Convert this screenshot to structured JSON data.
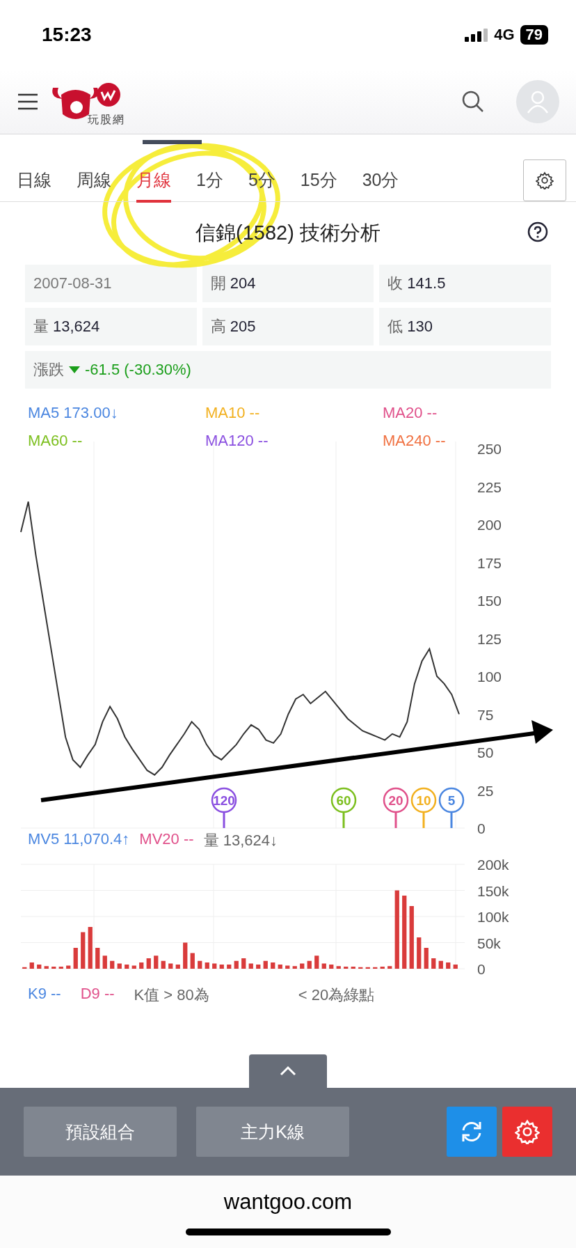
{
  "status_bar": {
    "time": "15:23",
    "network": "4G",
    "battery": "79"
  },
  "header": {
    "logo_text": "玩股網"
  },
  "tabs": [
    {
      "label": "日線",
      "selected": false
    },
    {
      "label": "周線",
      "selected": false
    },
    {
      "label": "月線",
      "selected": true
    },
    {
      "label": "1分",
      "selected": false
    },
    {
      "label": "5分",
      "selected": false
    },
    {
      "label": "15分",
      "selected": false
    },
    {
      "label": "30分",
      "selected": false
    }
  ],
  "title": "信錦(1582) 技術分析",
  "quote": [
    {
      "value": "2007-08-31"
    },
    {
      "label": "開",
      "value": "204"
    },
    {
      "label": "收",
      "value": "141.5"
    },
    {
      "label": "量",
      "value": "13,624"
    },
    {
      "label": "高",
      "value": "205"
    },
    {
      "label": "低",
      "value": "130"
    }
  ],
  "change": {
    "label": "漲跌",
    "value": "-61.5 (-30.30%)",
    "falling": true
  },
  "ma_legend": [
    {
      "name": "MA5",
      "value": "173.00↓",
      "color": "#4a86e0"
    },
    {
      "name": "MA10",
      "value": "--",
      "color": "#f2b01e"
    },
    {
      "name": "MA20",
      "value": "--",
      "color": "#e0508a"
    },
    {
      "name": "MA60",
      "value": "--",
      "color": "#7cbf1e"
    },
    {
      "name": "MA120",
      "value": "--",
      "color": "#8a4fe0"
    },
    {
      "name": "MA240",
      "value": "--",
      "color": "#f07040"
    }
  ],
  "price_chart": {
    "chart_data": {
      "type": "line",
      "grid": true,
      "categories": [
        null,
        null,
        null,
        null,
        null,
        null,
        null,
        null,
        null,
        null,
        null,
        null,
        null,
        null,
        null,
        null,
        null,
        null,
        null,
        null,
        null,
        null,
        null,
        null,
        null,
        null,
        null,
        null,
        null,
        null,
        null,
        null,
        null,
        null,
        null,
        null,
        null,
        null,
        null,
        null,
        null,
        null,
        null,
        null,
        null,
        null,
        null,
        null,
        null,
        null,
        null,
        null,
        null,
        null,
        null,
        null,
        null,
        null,
        null,
        null
      ],
      "ylim": [
        0,
        250
      ],
      "yticks": [
        0,
        25,
        50,
        75,
        100,
        125,
        150,
        175,
        200,
        225,
        250
      ],
      "series": [
        {
          "color": "#333333",
          "values": [
            195,
            215,
            180,
            150,
            120,
            90,
            60,
            45,
            40,
            48,
            55,
            70,
            80,
            72,
            60,
            52,
            45,
            38,
            35,
            40,
            48,
            55,
            62,
            70,
            65,
            55,
            48,
            45,
            50,
            55,
            62,
            68,
            65,
            58,
            56,
            62,
            75,
            85,
            88,
            82,
            86,
            90,
            84,
            78,
            72,
            68,
            64,
            62,
            60,
            58,
            62,
            60,
            70,
            95,
            110,
            118,
            100,
            95,
            88,
            75
          ]
        }
      ]
    },
    "markers": [
      {
        "label": "120",
        "color": "#8a4fe0"
      },
      {
        "label": "60",
        "color": "#7cbf1e"
      },
      {
        "label": "20",
        "color": "#e0508a"
      },
      {
        "label": "10",
        "color": "#f2b01e"
      },
      {
        "label": "5",
        "color": "#4a86e0"
      }
    ]
  },
  "volume_legend": [
    {
      "text": "MV5 11,070.4↑",
      "color": "#4a86e0"
    },
    {
      "text": "MV20 --",
      "color": "#e0508a"
    },
    {
      "text": "量 13,624↓",
      "color": "#666666"
    }
  ],
  "volume_chart": {
    "chart_data": {
      "type": "bar",
      "grid": true,
      "ylim": [
        0,
        200000
      ],
      "yticks": [
        {
          "value": 0,
          "label": "0"
        },
        {
          "value": 50000,
          "label": "50k"
        },
        {
          "value": 100000,
          "label": "100k"
        },
        {
          "value": 150000,
          "label": "150k"
        },
        {
          "value": 200000,
          "label": "200k"
        }
      ],
      "series": [
        {
          "color": "#d93b3b",
          "values": [
            3000,
            12000,
            8000,
            5000,
            4000,
            4000,
            6000,
            40000,
            70000,
            80000,
            40000,
            25000,
            15000,
            10000,
            8000,
            6000,
            12000,
            20000,
            25000,
            15000,
            10000,
            8000,
            50000,
            30000,
            15000,
            12000,
            10000,
            8000,
            8000,
            15000,
            20000,
            10000,
            8000,
            15000,
            12000,
            8000,
            6000,
            5000,
            10000,
            15000,
            25000,
            10000,
            8000,
            5000,
            4000,
            4000,
            3000,
            3000,
            3000,
            4000,
            5000,
            150000,
            140000,
            120000,
            60000,
            40000,
            20000,
            15000,
            12000,
            8000
          ]
        }
      ]
    }
  },
  "kd_legend": [
    {
      "text": "K9 --",
      "color": "#4a86e0"
    },
    {
      "text": "D9 --",
      "color": "#e0508a"
    },
    {
      "text": "K值 > 80為",
      "color": "#666666"
    },
    {
      "text": "< 20為綠點",
      "color": "#666666"
    }
  ],
  "bottom_bar": {
    "buttons": [
      "預設組合",
      "主力K線"
    ]
  },
  "browser": {
    "url": "wantgoo.com"
  }
}
